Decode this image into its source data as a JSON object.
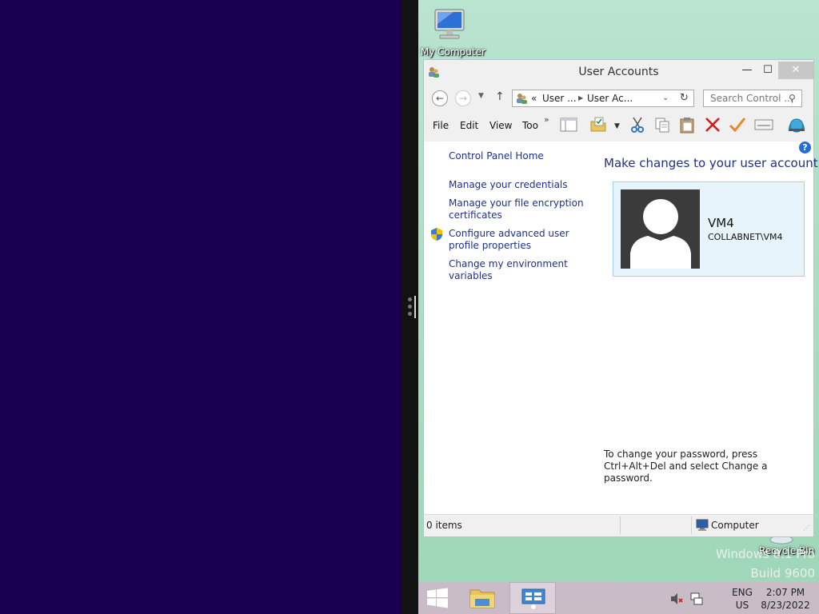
{
  "desktop": {
    "icons": [
      {
        "label": "My Computer"
      },
      {
        "label": "Recycle Bin"
      }
    ],
    "watermark": {
      "line1": "Windows 8.1 Pro",
      "line2": "Build 9600"
    }
  },
  "window": {
    "title": "User Accounts",
    "controls": {
      "minimize": "—",
      "maximize": "☐",
      "close": "✕"
    },
    "address": {
      "sep": "«",
      "crumbs": [
        "User ...",
        "User Ac..."
      ]
    },
    "search_placeholder": "Search Control ...",
    "menu": [
      "File",
      "Edit",
      "View",
      "Too"
    ],
    "menu_more": "»",
    "toolbar_icons": [
      "layout-icon",
      "folder-check-icon",
      "cut-icon",
      "copy-icon",
      "paste-icon",
      "delete-icon",
      "check-icon",
      "properties-icon",
      "globe-icon"
    ],
    "nav": {
      "home": "Control Panel Home",
      "links": [
        "Manage your credentials",
        "Manage your file encryption certificates",
        "Configure advanced user profile properties",
        "Change my environment variables"
      ]
    },
    "heading": "Make changes to your user account",
    "help": "?",
    "user": {
      "name": "VM4",
      "account": "COLLABNET\\VM4"
    },
    "password_note": "To change your password, press Ctrl+Alt+Del and select Change a password.",
    "status": {
      "items": "0 items",
      "location": "Computer"
    }
  },
  "taskbar": {
    "lang": "ENG",
    "region": "US",
    "time": "2:07 PM",
    "date": "8/23/2022"
  },
  "colors": {
    "left_bg": "#1a0050",
    "link": "#1e3287",
    "card_bg": "#e8f4fb",
    "card_border": "#9fd3ea"
  }
}
